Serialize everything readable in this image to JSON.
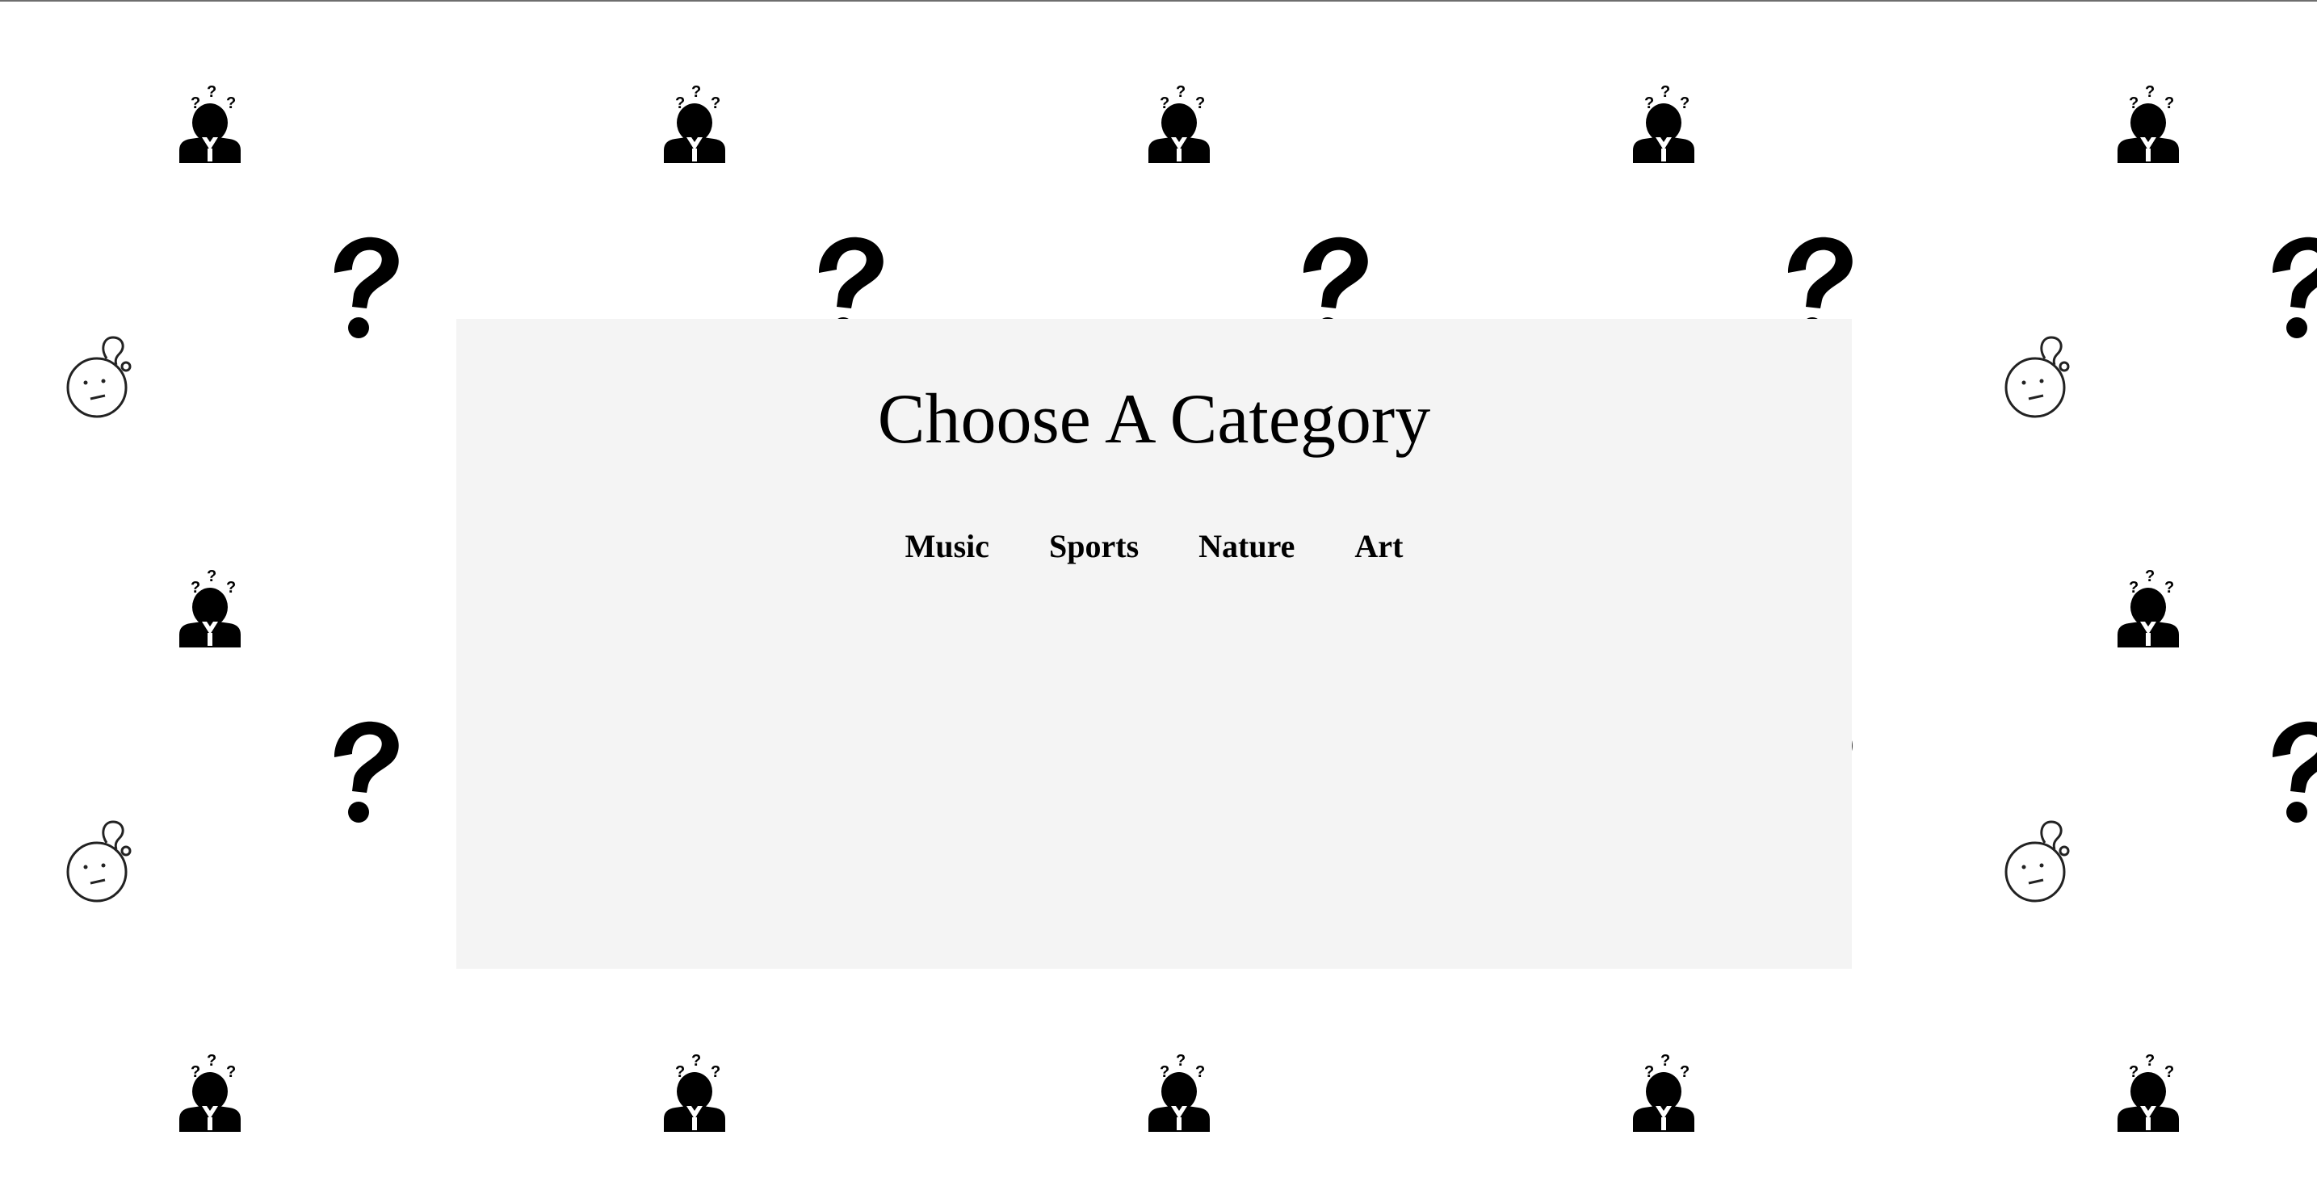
{
  "page": {
    "title": "Choose A Category",
    "background_color": "#ffffff",
    "card_color": "#f4f4f4"
  },
  "pattern": {
    "icons": [
      "confused-person-icon",
      "question-mark-icon",
      "thinking-face-icon"
    ]
  },
  "categories": [
    {
      "label": "Music"
    },
    {
      "label": "Sports"
    },
    {
      "label": "Nature"
    },
    {
      "label": "Art"
    }
  ]
}
